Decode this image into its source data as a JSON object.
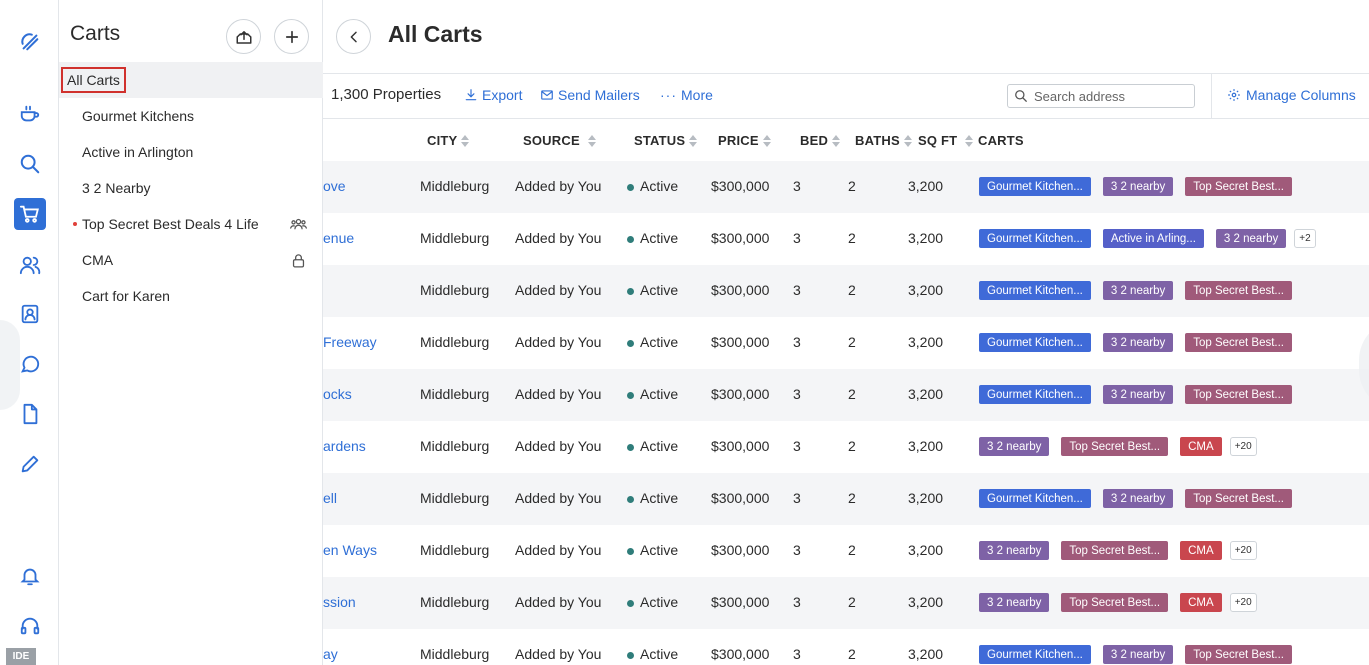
{
  "rail": {
    "icons": [
      "logo-icon",
      "coffee-icon",
      "search-icon",
      "cart-icon",
      "people-icon",
      "contacts-icon",
      "chat-icon",
      "document-icon",
      "pencil-icon",
      "bell-icon",
      "headset-icon"
    ],
    "ide_label": "IDE",
    "accent": "#2f6fd6"
  },
  "panel": {
    "title": "Carts",
    "items": [
      {
        "label": "All Carts",
        "selected": true
      },
      {
        "label": "Gourmet Kitchens"
      },
      {
        "label": "Active in Arlington"
      },
      {
        "label": "3 2 Nearby"
      },
      {
        "label": "Top Secret Best Deals 4 Life",
        "dot": true,
        "icon": "group-icon"
      },
      {
        "label": "CMA",
        "icon": "lock-icon"
      },
      {
        "label": "Cart for Karen"
      }
    ]
  },
  "main": {
    "title": "All Carts",
    "toolbar": {
      "count": "1,300 Properties",
      "export": "Export",
      "send_mailers": "Send Mailers",
      "more": "More",
      "search_placeholder": "Search address",
      "manage_columns": "Manage Columns"
    },
    "columns": [
      "CITY",
      "SOURCE",
      "STATUS",
      "PRICE",
      "BED",
      "BATHS",
      "SQ FT",
      "CARTS"
    ],
    "tag_colors": {
      "Gourmet Kitchen...": "#3f6ad8",
      "3 2 nearby": "#7e62a6",
      "Top Secret Best...": "#a05a7a",
      "Active in Arling...": "#5560c9",
      "CMA": "#c9464e"
    },
    "rows": [
      {
        "addr": "ove",
        "city": "Middleburg",
        "source": "Added by You",
        "status": "Active",
        "price": "$300,000",
        "bed": "3",
        "baths": "2",
        "sqft": "3,200",
        "tags": [
          "Gourmet Kitchen...",
          "3 2 nearby",
          "Top Secret Best..."
        ],
        "more": ""
      },
      {
        "addr": "enue",
        "city": "Middleburg",
        "source": "Added by You",
        "status": "Active",
        "price": "$300,000",
        "bed": "3",
        "baths": "2",
        "sqft": "3,200",
        "tags": [
          "Gourmet Kitchen...",
          "Active in Arling...",
          "3 2 nearby"
        ],
        "more": "+2"
      },
      {
        "addr": "",
        "city": "Middleburg",
        "source": "Added by You",
        "status": "Active",
        "price": "$300,000",
        "bed": "3",
        "baths": "2",
        "sqft": "3,200",
        "tags": [
          "Gourmet Kitchen...",
          "3 2 nearby",
          "Top Secret Best..."
        ],
        "more": ""
      },
      {
        "addr": "Freeway",
        "city": "Middleburg",
        "source": "Added by You",
        "status": "Active",
        "price": "$300,000",
        "bed": "3",
        "baths": "2",
        "sqft": "3,200",
        "tags": [
          "Gourmet Kitchen...",
          "3 2 nearby",
          "Top Secret Best..."
        ],
        "more": ""
      },
      {
        "addr": "ocks",
        "city": "Middleburg",
        "source": "Added by You",
        "status": "Active",
        "price": "$300,000",
        "bed": "3",
        "baths": "2",
        "sqft": "3,200",
        "tags": [
          "Gourmet Kitchen...",
          "3 2 nearby",
          "Top Secret Best..."
        ],
        "more": ""
      },
      {
        "addr": "ardens",
        "city": "Middleburg",
        "source": "Added by You",
        "status": "Active",
        "price": "$300,000",
        "bed": "3",
        "baths": "2",
        "sqft": "3,200",
        "tags": [
          "3 2 nearby",
          "Top Secret Best...",
          "CMA"
        ],
        "more": "+20"
      },
      {
        "addr": "ell",
        "city": "Middleburg",
        "source": "Added by You",
        "status": "Active",
        "price": "$300,000",
        "bed": "3",
        "baths": "2",
        "sqft": "3,200",
        "tags": [
          "Gourmet Kitchen...",
          "3 2 nearby",
          "Top Secret Best..."
        ],
        "more": ""
      },
      {
        "addr": "en Ways",
        "city": "Middleburg",
        "source": "Added by You",
        "status": "Active",
        "price": "$300,000",
        "bed": "3",
        "baths": "2",
        "sqft": "3,200",
        "tags": [
          "3 2 nearby",
          "Top Secret Best...",
          "CMA"
        ],
        "more": "+20"
      },
      {
        "addr": "ssion",
        "city": "Middleburg",
        "source": "Added by You",
        "status": "Active",
        "price": "$300,000",
        "bed": "3",
        "baths": "2",
        "sqft": "3,200",
        "tags": [
          "3 2 nearby",
          "Top Secret Best...",
          "CMA"
        ],
        "more": "+20"
      },
      {
        "addr": "ay",
        "city": "Middleburg",
        "source": "Added by You",
        "status": "Active",
        "price": "$300,000",
        "bed": "3",
        "baths": "2",
        "sqft": "3,200",
        "tags": [
          "Gourmet Kitchen...",
          "3 2 nearby",
          "Top Secret Best..."
        ],
        "more": ""
      }
    ]
  }
}
